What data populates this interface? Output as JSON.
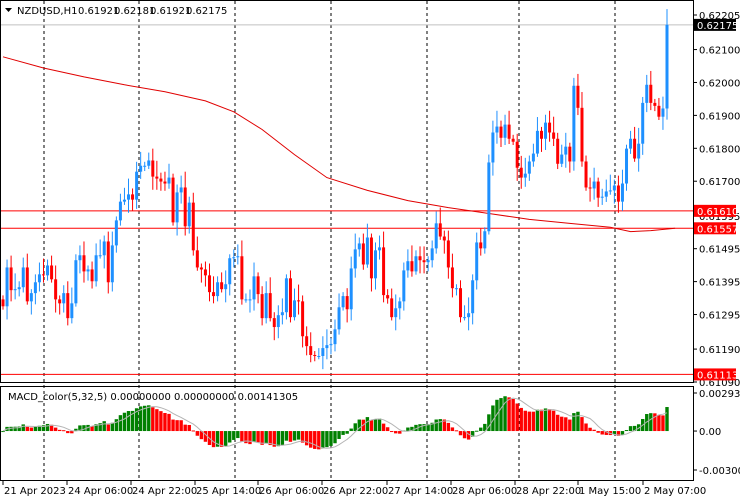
{
  "header": {
    "symbol": "NZDUSD,H1",
    "open": "0.61921",
    "high": "0.62181",
    "low": "0.61921",
    "close": "0.62175"
  },
  "colors": {
    "bull": "#1e90ff",
    "bear": "#ff0000",
    "ma": "#e00000",
    "level": "#ff0000",
    "macd_up": "#008000",
    "macd_down": "#ff0000",
    "signal": "#b4b4b4"
  },
  "chart_data": {
    "type": "candlestick",
    "price_axis": {
      "min": 0.6109,
      "max": 0.62205,
      "ticks": [
        "0.62205",
        "0.62100",
        "0.62000",
        "0.61900",
        "0.61800",
        "0.61700",
        "0.61595",
        "0.61495",
        "0.61395",
        "0.61295",
        "0.61190",
        "0.61090"
      ]
    },
    "current_price": "0.62175",
    "levels": [
      {
        "label": "0.61610",
        "value": 0.6161
      },
      {
        "label": "0.61557",
        "value": 0.61557
      },
      {
        "label": "0.61113",
        "value": 0.61113
      }
    ],
    "first_open": 0.61341,
    "closes": [
      0.6132,
      0.61438,
      0.61369,
      0.61372,
      0.61378,
      0.61438,
      0.61335,
      0.6136,
      0.61393,
      0.61417,
      0.61414,
      0.61444,
      0.61402,
      0.61341,
      0.61329,
      0.6136,
      0.61284,
      0.61329,
      0.6146,
      0.61475,
      0.61426,
      0.61432,
      0.61396,
      0.61475,
      0.61475,
      0.61517,
      0.61393,
      0.61505,
      0.61581,
      0.61638,
      0.61644,
      0.6166,
      0.61644,
      0.61729,
      0.61747,
      0.61747,
      0.61763,
      0.61714,
      0.61708,
      0.61699,
      0.61693,
      0.61711,
      0.61575,
      0.61666,
      0.61681,
      0.61563,
      0.61635,
      0.6149,
      0.61438,
      0.61432,
      0.61414,
      0.61363,
      0.61351,
      0.61393,
      0.61372,
      0.61387,
      0.61466,
      0.61469,
      0.61472,
      0.61341,
      0.61341,
      0.61341,
      0.61411,
      0.61357,
      0.61284,
      0.6136,
      0.61284,
      0.61257,
      0.61293,
      0.61302,
      0.61405,
      0.61287,
      0.61338,
      0.61335,
      0.61229,
      0.61199,
      0.61172,
      0.61169,
      0.61169,
      0.61193,
      0.61202,
      0.61205,
      0.6125,
      0.61317,
      0.61351,
      0.61311,
      0.61435,
      0.61493,
      0.61511,
      0.61447,
      0.61529,
      0.61405,
      0.6149,
      0.61499,
      0.61354,
      0.61344,
      0.61287,
      0.61314,
      0.61335,
      0.61429,
      0.61457,
      0.61426,
      0.61472,
      0.6146,
      0.61454,
      0.6146,
      0.61496,
      0.61572,
      0.61532,
      0.6152,
      0.61438,
      0.61375,
      0.61375,
      0.61287,
      0.61287,
      0.61299,
      0.61399,
      0.61514,
      0.61496,
      0.61548,
      0.61757,
      0.61848,
      0.61866,
      0.61832,
      0.61872,
      0.61829,
      0.6182,
      0.61741,
      0.61711,
      0.61723,
      0.6176,
      0.61784,
      0.61853,
      0.61829,
      0.61878,
      0.61848,
      0.61829,
      0.61753,
      0.61781,
      0.61805,
      0.6176,
      0.6199,
      0.61923,
      0.6176,
      0.61681,
      0.61678,
      0.61699,
      0.6165,
      0.61653,
      0.61669,
      0.61672,
      0.61687,
      0.61638,
      0.61693,
      0.61799,
      0.61829,
      0.61769,
      0.61814,
      0.61938,
      0.61993,
      0.61938,
      0.61929,
      0.61896,
      0.61921,
      0.62175
    ],
    "moving_average_keypoints": [
      [
        0,
        0.62078
      ],
      [
        10,
        0.62044
      ],
      [
        20,
        0.62017
      ],
      [
        30,
        0.61993
      ],
      [
        40,
        0.61972
      ],
      [
        50,
        0.61944
      ],
      [
        57,
        0.61911
      ],
      [
        64,
        0.61857
      ],
      [
        72,
        0.61781
      ],
      [
        80,
        0.61711
      ],
      [
        90,
        0.61672
      ],
      [
        100,
        0.61641
      ],
      [
        110,
        0.6162
      ],
      [
        120,
        0.61602
      ],
      [
        130,
        0.61584
      ],
      [
        140,
        0.61572
      ],
      [
        150,
        0.6156
      ],
      [
        155,
        0.61547
      ],
      [
        160,
        0.6155
      ],
      [
        166,
        0.61557
      ]
    ],
    "time_labels": [
      "21 Apr 2023",
      "24 Apr 06:00",
      "24 Apr 22:00",
      "25 Apr 14:00",
      "26 Apr 06:00",
      "26 Apr 22:00",
      "27 Apr 14:00",
      "28 Apr 06:00",
      "28 Apr 22:00",
      "1 May 15:00",
      "2 May 07:00"
    ],
    "macd": {
      "title": "MACD_color(5,32,5) 0.00000000 0.00000000 0.00141305",
      "params": [
        5,
        32,
        5
      ],
      "axis": {
        "max": 0.0029368,
        "min": -0.003007,
        "ticks": [
          "0.0029368",
          "0.00",
          "-0.003007"
        ]
      }
    }
  }
}
